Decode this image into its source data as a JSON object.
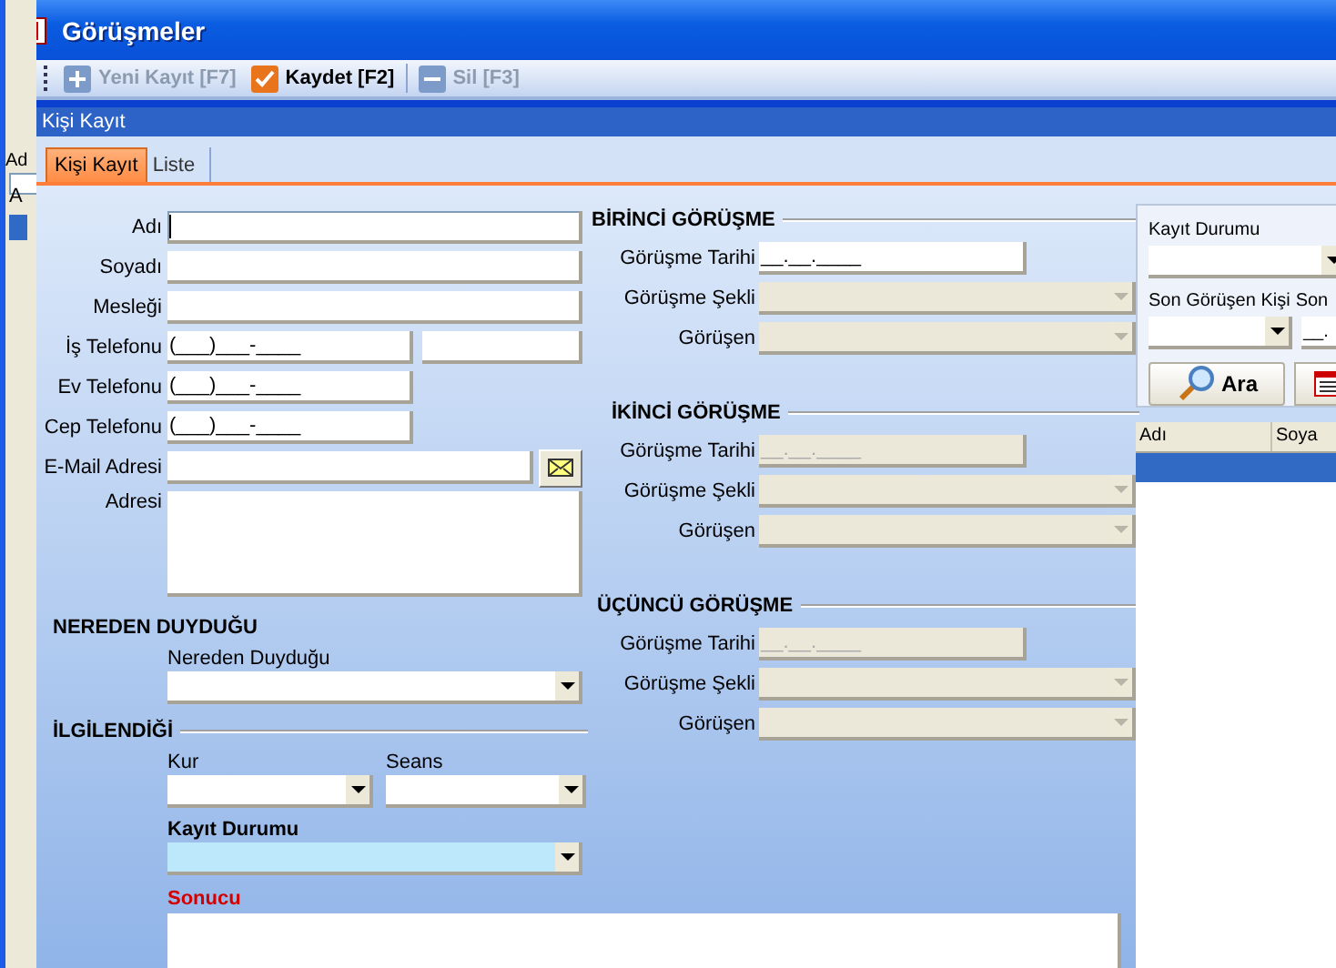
{
  "window": {
    "title": "Görüşmeler"
  },
  "background_window": {
    "texts": [
      "Ad",
      "A"
    ]
  },
  "toolbar": [
    {
      "label": "Yeni Kayıt [F7]",
      "kind": "new",
      "disabled": true
    },
    {
      "label": "Kaydet [F2]",
      "kind": "save",
      "disabled": false
    },
    {
      "label": "Sil [F3]",
      "kind": "delete",
      "disabled": true
    }
  ],
  "panel": {
    "title": "Kişi Kayıt"
  },
  "tabs": [
    {
      "label": "Kişi Kayıt",
      "selected": true
    },
    {
      "label": "Liste",
      "selected": false
    }
  ],
  "contact_fields": [
    {
      "label": "Adı",
      "kind": "text",
      "focused": true
    },
    {
      "label": "Soyadı",
      "kind": "text",
      "focused": false
    },
    {
      "label": "Mesleği",
      "kind": "text",
      "focused": false
    },
    {
      "label": "İş Telefonu",
      "kind": "phone_ext",
      "value": "(___)___-____",
      "focused": false
    },
    {
      "label": "Ev Telefonu",
      "kind": "phone",
      "value": "(___)___-____",
      "focused": false
    },
    {
      "label": "Cep Telefonu",
      "kind": "phone",
      "value": "(___)___-____",
      "focused": false
    },
    {
      "label": "E-Mail Adresi",
      "kind": "email",
      "focused": false
    },
    {
      "label": "Adresi",
      "kind": "textarea",
      "focused": false
    }
  ],
  "heard_from": {
    "title": "NEREDEN DUYDUĞU",
    "label": "Nereden Duyduğu"
  },
  "interest": {
    "title": "İLGİLENDİĞİ",
    "course_label": "Kur",
    "session_label": "Seans",
    "status_label": "Kayıt Durumu"
  },
  "result": {
    "label": "Sonucu"
  },
  "meetings": [
    {
      "title": "BİRİNCİ GÖRÜŞME",
      "fields": [
        {
          "label": "Görüşme Tarihi",
          "kind": "date",
          "value": "__.__.____",
          "disabled": false
        },
        {
          "label": "Görüşme Şekli",
          "kind": "select",
          "disabled": true
        },
        {
          "label": "Görüşen",
          "kind": "select",
          "disabled": true
        }
      ]
    },
    {
      "title": "İKİNCİ GÖRÜŞME",
      "fields": [
        {
          "label": "Görüşme Tarihi",
          "kind": "date",
          "value": "__.__.____",
          "disabled": true
        },
        {
          "label": "Görüşme Şekli",
          "kind": "select",
          "disabled": true
        },
        {
          "label": "Görüşen",
          "kind": "select",
          "disabled": true
        }
      ]
    },
    {
      "title": "ÜÇÜNCÜ GÖRÜŞME",
      "fields": [
        {
          "label": "Görüşme Tarihi",
          "kind": "date",
          "value": "__.__.____",
          "disabled": true
        },
        {
          "label": "Görüşme Şekli",
          "kind": "select",
          "disabled": true
        },
        {
          "label": "Görüşen",
          "kind": "select",
          "disabled": true
        }
      ]
    }
  ],
  "search": {
    "status_label": "Kayıt Durumu",
    "last_person_label": "Son Görüşen Kişi",
    "last_date_label": "Son",
    "last_date_value": "__.",
    "search_button": "Ara"
  },
  "list": {
    "columns": [
      "Adı",
      "Soya"
    ],
    "rows": [
      {
        "selected": true
      }
    ]
  }
}
